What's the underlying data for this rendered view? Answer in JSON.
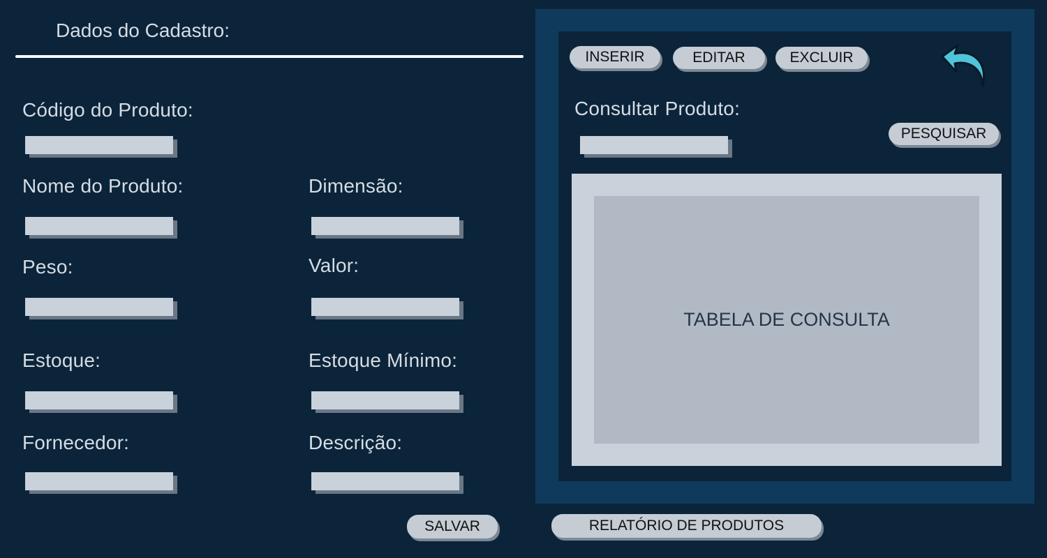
{
  "form": {
    "title": "Dados do Cadastro:",
    "fields": {
      "codigo": {
        "label": "Código do Produto:",
        "value": ""
      },
      "nome": {
        "label": "Nome do Produto:",
        "value": ""
      },
      "dimensao": {
        "label": "Dimensão:",
        "value": ""
      },
      "peso": {
        "label": "Peso:",
        "value": ""
      },
      "valor": {
        "label": "Valor:",
        "value": ""
      },
      "estoque": {
        "label": "Estoque:",
        "value": ""
      },
      "estoque_minimo": {
        "label": "Estoque Mínimo:",
        "value": ""
      },
      "fornecedor": {
        "label": "Fornecedor:",
        "value": ""
      },
      "descricao": {
        "label": "Descrição:",
        "value": ""
      }
    },
    "save_label": "SALVAR"
  },
  "panel": {
    "buttons": {
      "insert": "INSERIR",
      "edit": "EDITAR",
      "delete": "EXCLUIR"
    },
    "back_icon": "back-arrow-icon",
    "search": {
      "label": "Consultar Produto:",
      "value": "",
      "button": "PESQUISAR"
    },
    "table_placeholder": "TABELA DE CONSULTA"
  },
  "report_label": "RELATÓRIO DE PRODUTOS",
  "colors": {
    "background": "#0b2439",
    "panel_border": "#0f3a5c",
    "field": "#c9d1db",
    "button": "#c5ccd4",
    "accent_arrow": "#4fc3d9"
  }
}
